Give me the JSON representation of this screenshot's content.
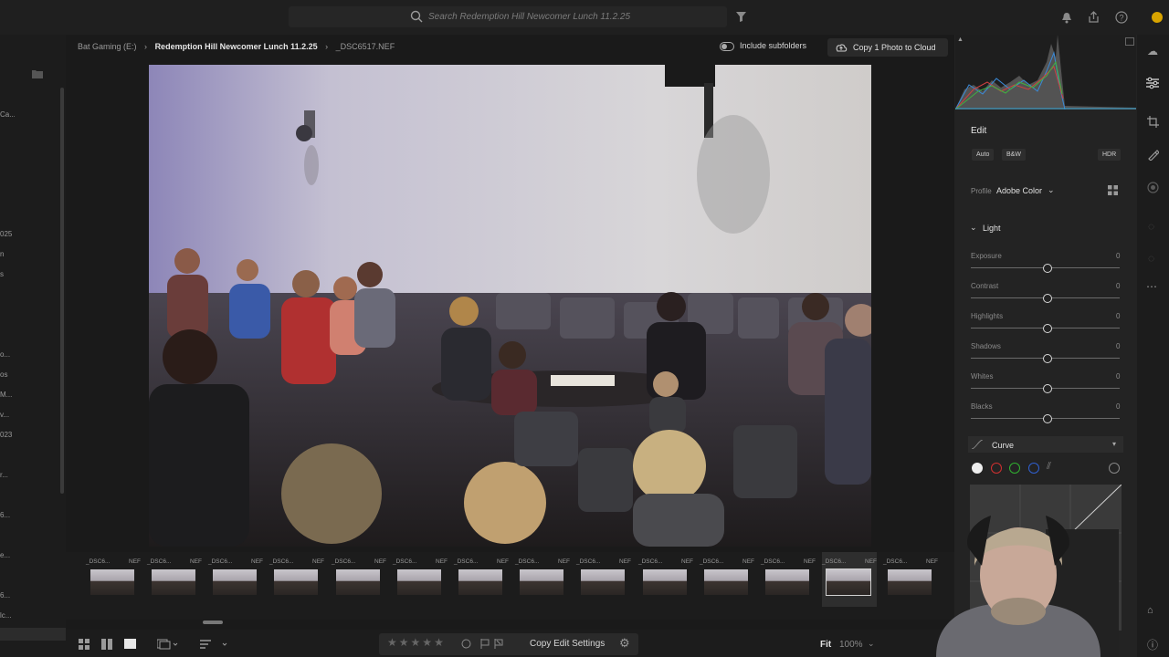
{
  "topbar": {
    "search_placeholder": "Search Redemption Hill Newcomer Lunch 11.2.25"
  },
  "sidebar_fragments": [
    "Ca...",
    "025",
    "n",
    "s",
    "o...",
    "os",
    "M...",
    "v...",
    "023",
    "r...",
    "6...",
    "e...",
    "6...",
    "lc...",
    "a"
  ],
  "breadcrumb": [
    "Bat Gaming (E:)",
    "Redemption Hill Newcomer Lunch 11.2.25",
    "_DSC6517.NEF"
  ],
  "include_subfolders": "Include subfolders",
  "copy_button": "Copy 1 Photo to Cloud",
  "filmstrip": {
    "prefix": "_DSC6...",
    "ext": "NEF",
    "count": 14,
    "selected_index": 12
  },
  "bottombar": {
    "copy_edit": "Copy Edit Settings",
    "fit": "Fit",
    "zoom": "100%",
    "stars": 5
  },
  "edit_panel": {
    "title": "Edit",
    "auto": "Auto",
    "bw": "B&W",
    "hdr": "HDR",
    "profile_label": "Profile",
    "profile_value": "Adobe Color",
    "light_section": "Light",
    "sliders": [
      {
        "label": "Exposure",
        "value": "0"
      },
      {
        "label": "Contrast",
        "value": "0"
      },
      {
        "label": "Highlights",
        "value": "0"
      },
      {
        "label": "Shadows",
        "value": "0"
      },
      {
        "label": "Whites",
        "value": "0"
      },
      {
        "label": "Blacks",
        "value": "0"
      }
    ],
    "curve_section": "Curve",
    "curve_channel_colors": [
      "#bbbbbb",
      "#d03030",
      "#30b030",
      "#3060d0"
    ]
  }
}
